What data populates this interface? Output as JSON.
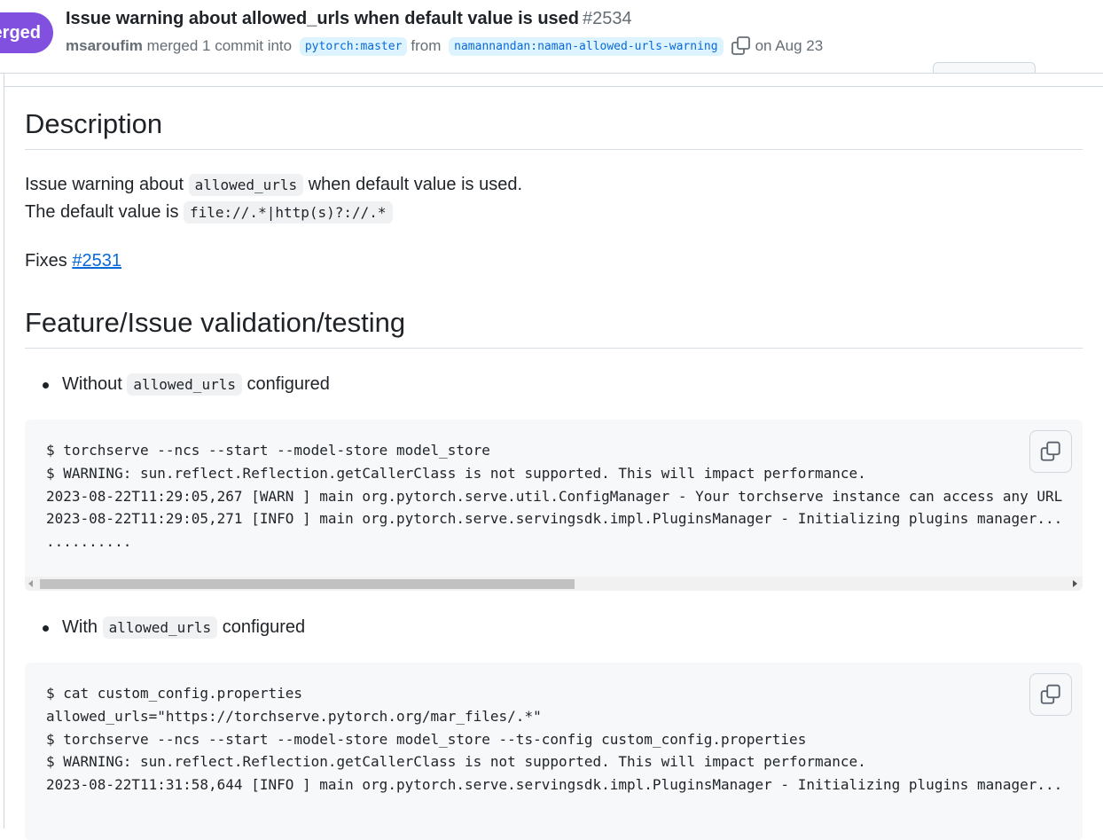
{
  "header": {
    "status_badge": "Merged",
    "title": "Issue warning about allowed_urls when default value is used",
    "number": "#2534",
    "author": "msaroufim",
    "merged_text": "merged 1 commit into",
    "base_branch": "pytorch:master",
    "from_text": "from",
    "head_branch": "namannandan:naman-allowed-urls-warning",
    "date": "on Aug 23"
  },
  "description": {
    "heading": "Description",
    "line1_before": "Issue warning about",
    "line1_code": "allowed_urls",
    "line1_after": "when default value is used.",
    "line2_before": "The default value is",
    "line2_code": "file://.*|http(s)?://.*",
    "fixes_label": "Fixes",
    "fixes_link": "#2531"
  },
  "testing": {
    "heading": "Feature/Issue validation/testing",
    "item1": {
      "before": "Without",
      "code": "allowed_urls",
      "after": "configured"
    },
    "code1": [
      "$ torchserve --ncs --start --model-store model_store",
      "$ WARNING: sun.reflect.Reflection.getCallerClass is not supported. This will impact performance.",
      "2023-08-22T11:29:05,267 [WARN ] main org.pytorch.serve.util.ConfigManager - Your torchserve instance can access any URL",
      "2023-08-22T11:29:05,271 [INFO ] main org.pytorch.serve.servingsdk.impl.PluginsManager - Initializing plugins manager...",
      ".........."
    ],
    "item2": {
      "before": "With",
      "code": "allowed_urls",
      "after": "configured"
    },
    "code2": [
      "$ cat custom_config.properties",
      "allowed_urls=\"https://torchserve.pytorch.org/mar_files/.*\"",
      "$ torchserve --ncs --start --model-store model_store --ts-config custom_config.properties",
      "$ WARNING: sun.reflect.Reflection.getCallerClass is not supported. This will impact performance.",
      "2023-08-22T11:31:58,644 [INFO ] main org.pytorch.serve.servingsdk.impl.PluginsManager - Initializing plugins manager..."
    ]
  },
  "colors": {
    "merged_purple": "#8250df",
    "link_blue": "#0969da",
    "branch_bg": "#ddf4ff",
    "code_bg": "#f6f8fa"
  }
}
